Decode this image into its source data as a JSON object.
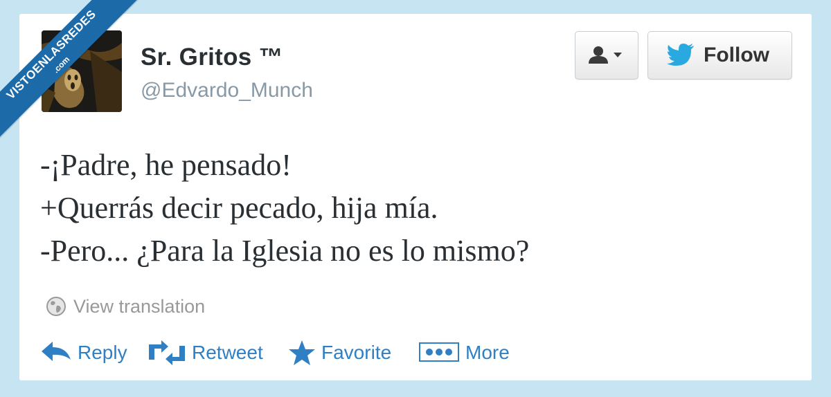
{
  "watermark": {
    "line1": "VISTOENLASREDES",
    "line2": ".com"
  },
  "profile": {
    "display_name": "Sr. Gritos ™",
    "handle": "@Edvardo_Munch",
    "avatar_icon": "scream-painting-avatar"
  },
  "header_buttons": {
    "user_menu_icon": "person-dropdown-icon",
    "follow_label": "Follow",
    "follow_icon": "twitter-bird-icon"
  },
  "tweet": {
    "lines": [
      "-¡Padre, he pensado!",
      "+Querrás decir pecado, hija mía.",
      "-Pero... ¿Para la Iglesia no es lo mismo?"
    ]
  },
  "translation": {
    "label": "View translation",
    "icon": "globe-icon"
  },
  "actions": [
    {
      "label": "Reply",
      "icon": "reply-arrow-icon"
    },
    {
      "label": "Retweet",
      "icon": "retweet-icon"
    },
    {
      "label": "Favorite",
      "icon": "star-icon"
    },
    {
      "label": "More",
      "icon": "more-dots-icon"
    }
  ],
  "colors": {
    "background": "#c6e4f2",
    "card": "#ffffff",
    "action_blue": "#2f7fc4",
    "twitter_blue": "#2aa9e0",
    "watermark_blue": "#1d6aa8",
    "muted_gray": "#8899a6"
  }
}
